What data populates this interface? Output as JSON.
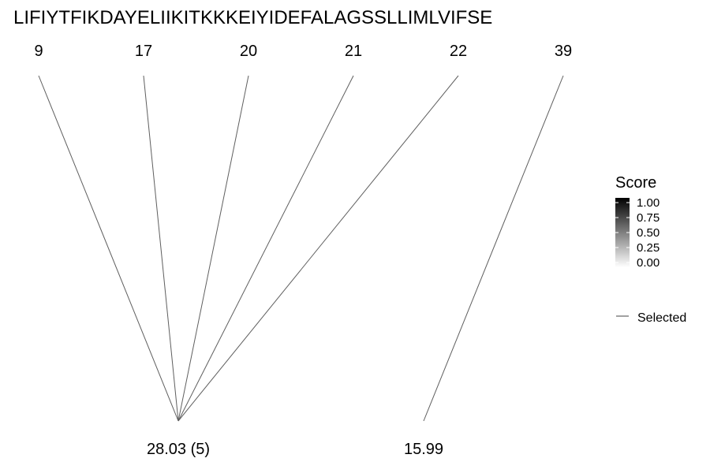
{
  "chart_data": {
    "type": "bipartite-link",
    "sequence": "LIFIYTFIKDAYELIIKITKKKEIYIDEFALAGSSLLIMLVIFSE",
    "top_positions": [
      "9",
      "17",
      "20",
      "21",
      "22",
      "39"
    ],
    "bottom_nodes": [
      "28.03 (5)",
      "15.99"
    ],
    "links": [
      {
        "from": "9",
        "to": "28.03 (5)",
        "score": 0.7
      },
      {
        "from": "17",
        "to": "28.03 (5)",
        "score": 0.7
      },
      {
        "from": "20",
        "to": "28.03 (5)",
        "score": 0.7
      },
      {
        "from": "21",
        "to": "28.03 (5)",
        "score": 0.7
      },
      {
        "from": "22",
        "to": "28.03 (5)",
        "score": 0.7
      },
      {
        "from": "39",
        "to": "15.99",
        "score": 0.7
      }
    ],
    "legend": {
      "title": "Score",
      "ticks": [
        "1.00",
        "0.75",
        "0.50",
        "0.25",
        "0.00"
      ],
      "gradient_colors": [
        "#000000",
        "#ffffff"
      ],
      "line_label": "Selected"
    }
  }
}
